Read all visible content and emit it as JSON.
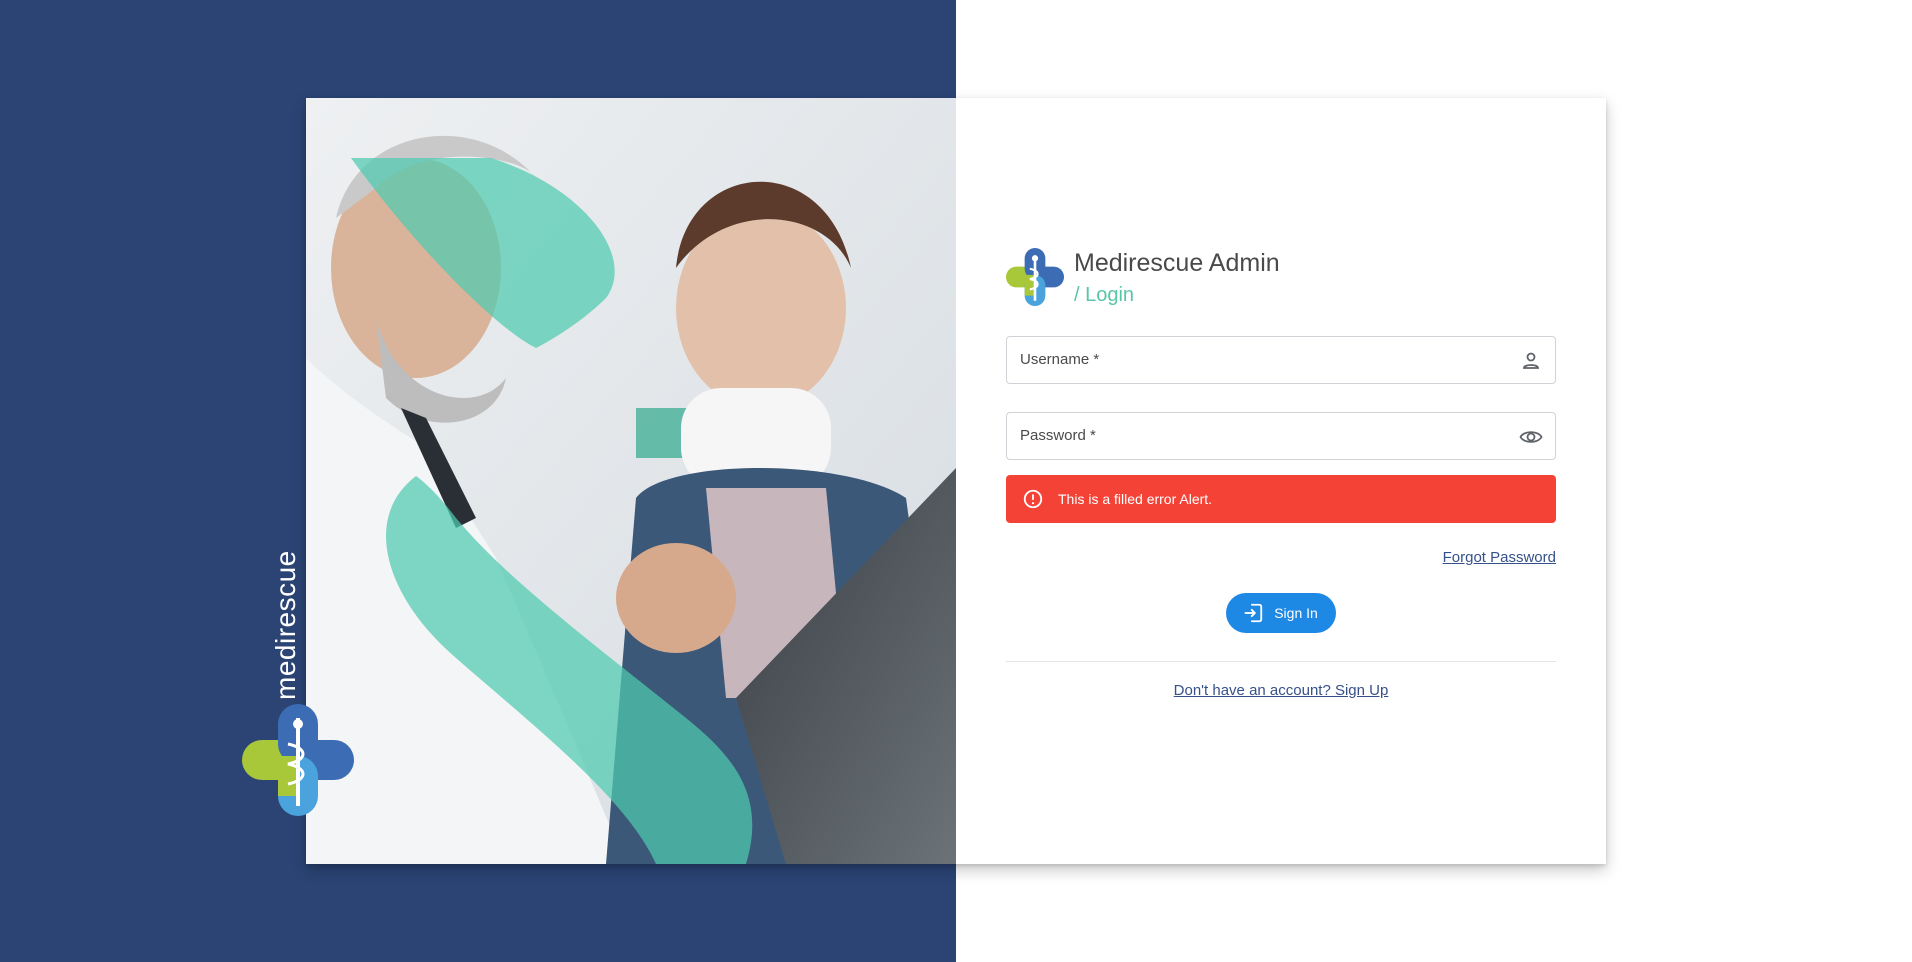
{
  "brand": {
    "name": "medirescue",
    "logo_icon": "medical-cross-caduceus-icon"
  },
  "header": {
    "app_title": "Medirescue Admin",
    "subtitle": "/ Login"
  },
  "form": {
    "username_label": "Username *",
    "username_icon": "user-icon",
    "password_label": "Password *",
    "password_icon": "eye-icon"
  },
  "alert": {
    "message": "This is a filled error Alert.",
    "icon": "error-circle-icon"
  },
  "links": {
    "forgot_password": "Forgot Password",
    "signup": "Don't have an account? Sign Up"
  },
  "buttons": {
    "sign_in": "Sign In",
    "sign_in_icon": "login-icon"
  },
  "colors": {
    "navy": "#2b4474",
    "teal": "#58c6a8",
    "alert_red": "#f44336",
    "primary_blue": "#1e88e5",
    "link_blue": "#36518a"
  }
}
